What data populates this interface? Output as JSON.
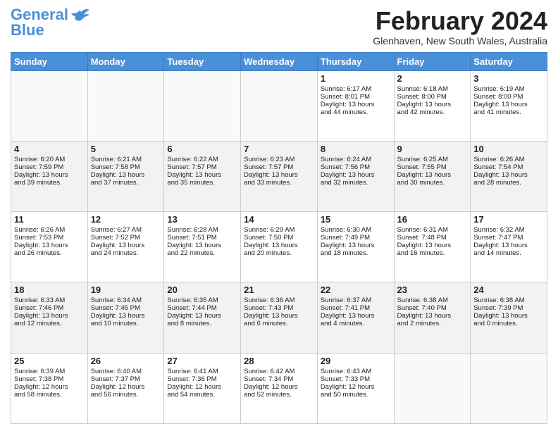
{
  "header": {
    "logo_general": "General",
    "logo_blue": "Blue",
    "month_title": "February 2024",
    "location": "Glenhaven, New South Wales, Australia"
  },
  "days_of_week": [
    "Sunday",
    "Monday",
    "Tuesday",
    "Wednesday",
    "Thursday",
    "Friday",
    "Saturday"
  ],
  "rows": [
    [
      {
        "day": "",
        "info": ""
      },
      {
        "day": "",
        "info": ""
      },
      {
        "day": "",
        "info": ""
      },
      {
        "day": "",
        "info": ""
      },
      {
        "day": "1",
        "info": "Sunrise: 6:17 AM\nSunset: 8:01 PM\nDaylight: 13 hours\nand 44 minutes."
      },
      {
        "day": "2",
        "info": "Sunrise: 6:18 AM\nSunset: 8:00 PM\nDaylight: 13 hours\nand 42 minutes."
      },
      {
        "day": "3",
        "info": "Sunrise: 6:19 AM\nSunset: 8:00 PM\nDaylight: 13 hours\nand 41 minutes."
      }
    ],
    [
      {
        "day": "4",
        "info": "Sunrise: 6:20 AM\nSunset: 7:59 PM\nDaylight: 13 hours\nand 39 minutes."
      },
      {
        "day": "5",
        "info": "Sunrise: 6:21 AM\nSunset: 7:58 PM\nDaylight: 13 hours\nand 37 minutes."
      },
      {
        "day": "6",
        "info": "Sunrise: 6:22 AM\nSunset: 7:57 PM\nDaylight: 13 hours\nand 35 minutes."
      },
      {
        "day": "7",
        "info": "Sunrise: 6:23 AM\nSunset: 7:57 PM\nDaylight: 13 hours\nand 33 minutes."
      },
      {
        "day": "8",
        "info": "Sunrise: 6:24 AM\nSunset: 7:56 PM\nDaylight: 13 hours\nand 32 minutes."
      },
      {
        "day": "9",
        "info": "Sunrise: 6:25 AM\nSunset: 7:55 PM\nDaylight: 13 hours\nand 30 minutes."
      },
      {
        "day": "10",
        "info": "Sunrise: 6:26 AM\nSunset: 7:54 PM\nDaylight: 13 hours\nand 28 minutes."
      }
    ],
    [
      {
        "day": "11",
        "info": "Sunrise: 6:26 AM\nSunset: 7:53 PM\nDaylight: 13 hours\nand 26 minutes."
      },
      {
        "day": "12",
        "info": "Sunrise: 6:27 AM\nSunset: 7:52 PM\nDaylight: 13 hours\nand 24 minutes."
      },
      {
        "day": "13",
        "info": "Sunrise: 6:28 AM\nSunset: 7:51 PM\nDaylight: 13 hours\nand 22 minutes."
      },
      {
        "day": "14",
        "info": "Sunrise: 6:29 AM\nSunset: 7:50 PM\nDaylight: 13 hours\nand 20 minutes."
      },
      {
        "day": "15",
        "info": "Sunrise: 6:30 AM\nSunset: 7:49 PM\nDaylight: 13 hours\nand 18 minutes."
      },
      {
        "day": "16",
        "info": "Sunrise: 6:31 AM\nSunset: 7:48 PM\nDaylight: 13 hours\nand 16 minutes."
      },
      {
        "day": "17",
        "info": "Sunrise: 6:32 AM\nSunset: 7:47 PM\nDaylight: 13 hours\nand 14 minutes."
      }
    ],
    [
      {
        "day": "18",
        "info": "Sunrise: 6:33 AM\nSunset: 7:46 PM\nDaylight: 13 hours\nand 12 minutes."
      },
      {
        "day": "19",
        "info": "Sunrise: 6:34 AM\nSunset: 7:45 PM\nDaylight: 13 hours\nand 10 minutes."
      },
      {
        "day": "20",
        "info": "Sunrise: 6:35 AM\nSunset: 7:44 PM\nDaylight: 13 hours\nand 8 minutes."
      },
      {
        "day": "21",
        "info": "Sunrise: 6:36 AM\nSunset: 7:43 PM\nDaylight: 13 hours\nand 6 minutes."
      },
      {
        "day": "22",
        "info": "Sunrise: 6:37 AM\nSunset: 7:41 PM\nDaylight: 13 hours\nand 4 minutes."
      },
      {
        "day": "23",
        "info": "Sunrise: 6:38 AM\nSunset: 7:40 PM\nDaylight: 13 hours\nand 2 minutes."
      },
      {
        "day": "24",
        "info": "Sunrise: 6:38 AM\nSunset: 7:39 PM\nDaylight: 13 hours\nand 0 minutes."
      }
    ],
    [
      {
        "day": "25",
        "info": "Sunrise: 6:39 AM\nSunset: 7:38 PM\nDaylight: 12 hours\nand 58 minutes."
      },
      {
        "day": "26",
        "info": "Sunrise: 6:40 AM\nSunset: 7:37 PM\nDaylight: 12 hours\nand 56 minutes."
      },
      {
        "day": "27",
        "info": "Sunrise: 6:41 AM\nSunset: 7:36 PM\nDaylight: 12 hours\nand 54 minutes."
      },
      {
        "day": "28",
        "info": "Sunrise: 6:42 AM\nSunset: 7:34 PM\nDaylight: 12 hours\nand 52 minutes."
      },
      {
        "day": "29",
        "info": "Sunrise: 6:43 AM\nSunset: 7:33 PM\nDaylight: 12 hours\nand 50 minutes."
      },
      {
        "day": "",
        "info": ""
      },
      {
        "day": "",
        "info": ""
      }
    ]
  ]
}
